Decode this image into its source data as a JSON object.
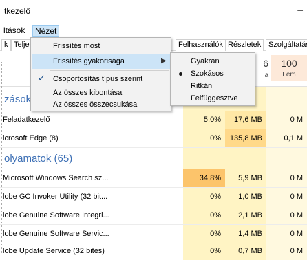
{
  "window": {
    "title": "tkezelő",
    "minimize_glyph": "–"
  },
  "menubar": {
    "items": [
      "ltások",
      "Nézet"
    ],
    "active": "Nézet"
  },
  "tabs": [
    "k",
    "Telje",
    "Felhasználók",
    "Részletek",
    "Szolgáltatások"
  ],
  "header": {
    "mem_big": "6",
    "mem_small": "a",
    "pct_big": "100",
    "pct_small": "Lem"
  },
  "sections": {
    "apps": "zások",
    "background": "olyamatok (65)"
  },
  "rows": [
    {
      "name": "Feladatkezelő",
      "cpu": "5,0%",
      "mem": "17,6 MB",
      "disk": "0 M"
    },
    {
      "name": "icrosoft Edge (8)",
      "cpu": "0%",
      "mem": "135,8 MB",
      "disk": "0,1 M"
    },
    {
      "name": "Microsoft Windows Search sz...",
      "cpu": "34,8%",
      "mem": "5,9 MB",
      "disk": "0 M"
    },
    {
      "name": "lobe GC Invoker Utility (32 bit...",
      "cpu": "0%",
      "mem": "1,0 MB",
      "disk": "0 M"
    },
    {
      "name": "lobe Genuine Software Integri...",
      "cpu": "0%",
      "mem": "2,1 MB",
      "disk": "0 M"
    },
    {
      "name": "lobe Genuine Software Servic...",
      "cpu": "0%",
      "mem": "1,4 MB",
      "disk": "0 M"
    },
    {
      "name": "lobe Update Service (32 bites)",
      "cpu": "0%",
      "mem": "0,7 MB",
      "disk": "0 M"
    }
  ],
  "view_menu": {
    "refresh_now": "Frissítés most",
    "refresh_speed": "Frissítés gyakorisága",
    "group_by_type": "Csoportosítás típus szerint",
    "expand_all": "Az összes kibontása",
    "collapse_all": "Az összes összecsukása"
  },
  "speed_submenu": {
    "high": "Gyakran",
    "normal": "Szokásos",
    "low": "Ritkán",
    "paused": "Felfüggesztve",
    "selected": "Szokásos"
  },
  "colors": {
    "menu_highlight": "#cce4f7",
    "cpu_high": "#fcc46b",
    "cell_light": "#fff4c4",
    "section_text": "#3c6fb5"
  },
  "icons": {
    "check": "checkmark-icon",
    "arrow": "submenu-arrow-icon",
    "bullet": "radio-bullet-icon"
  }
}
